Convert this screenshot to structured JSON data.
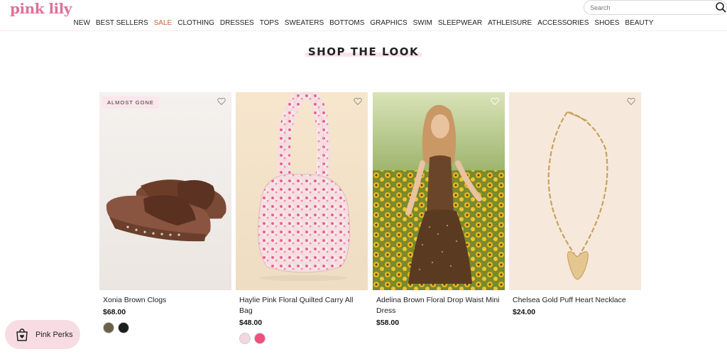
{
  "header": {
    "logo": "pink lily",
    "search": {
      "placeholder": "Search",
      "value": ""
    },
    "nav": [
      "NEW",
      "BEST SELLERS",
      "SALE",
      "CLOTHING",
      "DRESSES",
      "TOPS",
      "SWEATERS",
      "BOTTOMS",
      "GRAPHICS",
      "SWIM",
      "SLEEPWEAR",
      "ATHLEISURE",
      "ACCESSORIES",
      "SHOES",
      "BEAUTY"
    ],
    "sale_color": "#c8623d"
  },
  "section": {
    "title": "SHOP THE LOOK"
  },
  "products": [
    {
      "name": "Xonia Brown Clogs",
      "price": "$68.00",
      "badge": "ALMOST GONE",
      "swatches": [
        "#6b6146",
        "#1c1c1c"
      ],
      "icon": "heart-icon"
    },
    {
      "name": "Haylie Pink Floral Quilted Carry All Bag",
      "price": "$48.00",
      "swatches": [
        "#f3d9de",
        "#ee4f7c"
      ],
      "icon": "heart-icon"
    },
    {
      "name": "Adelina Brown Floral Drop Waist Mini Dress",
      "price": "$58.00",
      "icon": "heart-icon"
    },
    {
      "name": "Chelsea Gold Puff Heart Necklace",
      "price": "$24.00",
      "icon": "heart-icon"
    }
  ],
  "perks": {
    "label": "Pink Perks",
    "icon": "shopping-bag-heart-icon"
  },
  "colors": {
    "brand": "#e0709a",
    "perks_bg": "#f7dde3",
    "badge_bg": "#fbe6ec"
  }
}
